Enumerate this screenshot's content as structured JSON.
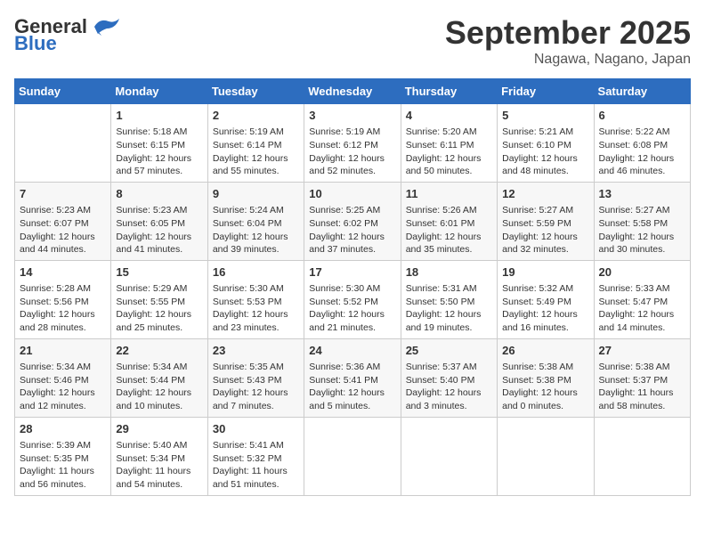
{
  "header": {
    "logo_general": "General",
    "logo_blue": "Blue",
    "month": "September 2025",
    "location": "Nagawa, Nagano, Japan"
  },
  "weekdays": [
    "Sunday",
    "Monday",
    "Tuesday",
    "Wednesday",
    "Thursday",
    "Friday",
    "Saturday"
  ],
  "weeks": [
    [
      {
        "day": "",
        "info": ""
      },
      {
        "day": "1",
        "info": "Sunrise: 5:18 AM\nSunset: 6:15 PM\nDaylight: 12 hours\nand 57 minutes."
      },
      {
        "day": "2",
        "info": "Sunrise: 5:19 AM\nSunset: 6:14 PM\nDaylight: 12 hours\nand 55 minutes."
      },
      {
        "day": "3",
        "info": "Sunrise: 5:19 AM\nSunset: 6:12 PM\nDaylight: 12 hours\nand 52 minutes."
      },
      {
        "day": "4",
        "info": "Sunrise: 5:20 AM\nSunset: 6:11 PM\nDaylight: 12 hours\nand 50 minutes."
      },
      {
        "day": "5",
        "info": "Sunrise: 5:21 AM\nSunset: 6:10 PM\nDaylight: 12 hours\nand 48 minutes."
      },
      {
        "day": "6",
        "info": "Sunrise: 5:22 AM\nSunset: 6:08 PM\nDaylight: 12 hours\nand 46 minutes."
      }
    ],
    [
      {
        "day": "7",
        "info": "Sunrise: 5:23 AM\nSunset: 6:07 PM\nDaylight: 12 hours\nand 44 minutes."
      },
      {
        "day": "8",
        "info": "Sunrise: 5:23 AM\nSunset: 6:05 PM\nDaylight: 12 hours\nand 41 minutes."
      },
      {
        "day": "9",
        "info": "Sunrise: 5:24 AM\nSunset: 6:04 PM\nDaylight: 12 hours\nand 39 minutes."
      },
      {
        "day": "10",
        "info": "Sunrise: 5:25 AM\nSunset: 6:02 PM\nDaylight: 12 hours\nand 37 minutes."
      },
      {
        "day": "11",
        "info": "Sunrise: 5:26 AM\nSunset: 6:01 PM\nDaylight: 12 hours\nand 35 minutes."
      },
      {
        "day": "12",
        "info": "Sunrise: 5:27 AM\nSunset: 5:59 PM\nDaylight: 12 hours\nand 32 minutes."
      },
      {
        "day": "13",
        "info": "Sunrise: 5:27 AM\nSunset: 5:58 PM\nDaylight: 12 hours\nand 30 minutes."
      }
    ],
    [
      {
        "day": "14",
        "info": "Sunrise: 5:28 AM\nSunset: 5:56 PM\nDaylight: 12 hours\nand 28 minutes."
      },
      {
        "day": "15",
        "info": "Sunrise: 5:29 AM\nSunset: 5:55 PM\nDaylight: 12 hours\nand 25 minutes."
      },
      {
        "day": "16",
        "info": "Sunrise: 5:30 AM\nSunset: 5:53 PM\nDaylight: 12 hours\nand 23 minutes."
      },
      {
        "day": "17",
        "info": "Sunrise: 5:30 AM\nSunset: 5:52 PM\nDaylight: 12 hours\nand 21 minutes."
      },
      {
        "day": "18",
        "info": "Sunrise: 5:31 AM\nSunset: 5:50 PM\nDaylight: 12 hours\nand 19 minutes."
      },
      {
        "day": "19",
        "info": "Sunrise: 5:32 AM\nSunset: 5:49 PM\nDaylight: 12 hours\nand 16 minutes."
      },
      {
        "day": "20",
        "info": "Sunrise: 5:33 AM\nSunset: 5:47 PM\nDaylight: 12 hours\nand 14 minutes."
      }
    ],
    [
      {
        "day": "21",
        "info": "Sunrise: 5:34 AM\nSunset: 5:46 PM\nDaylight: 12 hours\nand 12 minutes."
      },
      {
        "day": "22",
        "info": "Sunrise: 5:34 AM\nSunset: 5:44 PM\nDaylight: 12 hours\nand 10 minutes."
      },
      {
        "day": "23",
        "info": "Sunrise: 5:35 AM\nSunset: 5:43 PM\nDaylight: 12 hours\nand 7 minutes."
      },
      {
        "day": "24",
        "info": "Sunrise: 5:36 AM\nSunset: 5:41 PM\nDaylight: 12 hours\nand 5 minutes."
      },
      {
        "day": "25",
        "info": "Sunrise: 5:37 AM\nSunset: 5:40 PM\nDaylight: 12 hours\nand 3 minutes."
      },
      {
        "day": "26",
        "info": "Sunrise: 5:38 AM\nSunset: 5:38 PM\nDaylight: 12 hours\nand 0 minutes."
      },
      {
        "day": "27",
        "info": "Sunrise: 5:38 AM\nSunset: 5:37 PM\nDaylight: 11 hours\nand 58 minutes."
      }
    ],
    [
      {
        "day": "28",
        "info": "Sunrise: 5:39 AM\nSunset: 5:35 PM\nDaylight: 11 hours\nand 56 minutes."
      },
      {
        "day": "29",
        "info": "Sunrise: 5:40 AM\nSunset: 5:34 PM\nDaylight: 11 hours\nand 54 minutes."
      },
      {
        "day": "30",
        "info": "Sunrise: 5:41 AM\nSunset: 5:32 PM\nDaylight: 11 hours\nand 51 minutes."
      },
      {
        "day": "",
        "info": ""
      },
      {
        "day": "",
        "info": ""
      },
      {
        "day": "",
        "info": ""
      },
      {
        "day": "",
        "info": ""
      }
    ]
  ]
}
